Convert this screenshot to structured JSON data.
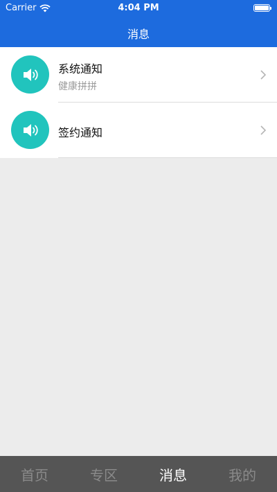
{
  "status_bar": {
    "carrier": "Carrier",
    "time": "4:04 PM"
  },
  "nav": {
    "title": "消息"
  },
  "messages": [
    {
      "title": "系统通知",
      "subtitle": "健康拼拼",
      "icon": "speaker-icon"
    },
    {
      "title": "签约通知",
      "subtitle": "",
      "icon": "speaker-icon"
    }
  ],
  "tabs": [
    {
      "label": "首页",
      "active": false
    },
    {
      "label": "专区",
      "active": false
    },
    {
      "label": "消息",
      "active": true
    },
    {
      "label": "我的",
      "active": false
    }
  ],
  "colors": {
    "header": "#1d6bde",
    "icon_circle": "#21c4bd",
    "tabbar": "#555555",
    "tab_active": "#ffffff",
    "tab_inactive": "#8a8a8a",
    "background": "#ececec"
  }
}
